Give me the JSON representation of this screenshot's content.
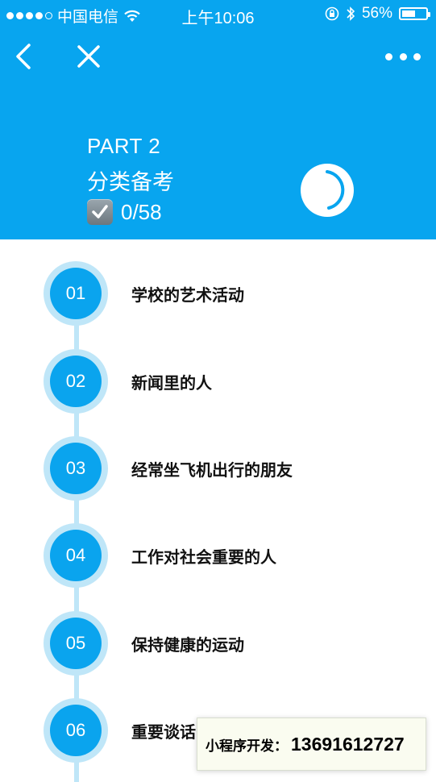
{
  "status_bar": {
    "carrier": "中国电信",
    "time": "上午10:06",
    "battery": "56%",
    "battery_level": 0.56
  },
  "nav": {
    "back_icon": "chevron-left-icon",
    "close_icon": "close-icon",
    "more_icon": "more-dots-icon"
  },
  "header": {
    "part": "PART 2",
    "subtitle": "分类备考",
    "progress_text": "0/58",
    "progress_fraction": 0.0
  },
  "topics": [
    {
      "number": "01",
      "title": "学校的艺术活动"
    },
    {
      "number": "02",
      "title": "新闻里的人"
    },
    {
      "number": "03",
      "title": "经常坐飞机出行的朋友"
    },
    {
      "number": "04",
      "title": "工作对社会重要的人"
    },
    {
      "number": "05",
      "title": "保持健康的运动"
    },
    {
      "number": "06",
      "title": "重要谈话"
    }
  ],
  "promo": {
    "label": "小程序开发：",
    "phone": "13691612727"
  },
  "colors": {
    "header_bg": "#08a5ef",
    "badge_fill": "#0aa4ee",
    "timeline": "#bfe6f8"
  }
}
